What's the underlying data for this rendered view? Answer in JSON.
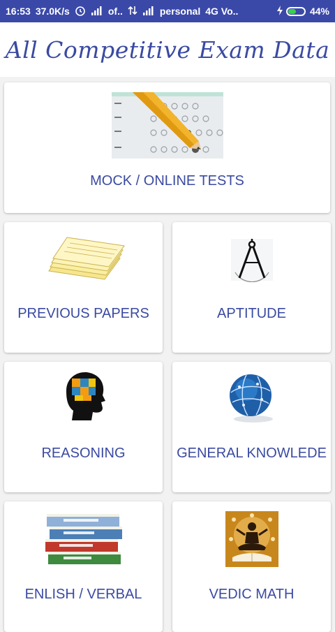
{
  "status_bar": {
    "time": "16:53",
    "speed": "37.0K/s",
    "carrier1": "of..",
    "carrier2": "personal",
    "network": "4G Vo..",
    "battery": "44%"
  },
  "header": {
    "title": "All Competitive Exam Data"
  },
  "cards": {
    "mock": {
      "label": "MOCK / ONLINE TESTS",
      "icon": "answer-sheet-pencil-icon"
    },
    "previous": {
      "label": "PREVIOUS PAPERS",
      "icon": "paper-stack-icon"
    },
    "aptitude": {
      "label": "APTITUDE",
      "icon": "compass-icon"
    },
    "reasoning": {
      "label": "REASONING",
      "icon": "brain-puzzle-icon"
    },
    "gk": {
      "label": "GENERAL KNOWLEDE",
      "icon": "globe-icon"
    },
    "english": {
      "label": "ENLISH / VERBAL",
      "icon": "book-stack-icon"
    },
    "vedic": {
      "label": "VEDIC MATH",
      "icon": "meditation-icon"
    }
  },
  "colors": {
    "primary": "#3a49a8",
    "accent": "#3a4aa2"
  }
}
